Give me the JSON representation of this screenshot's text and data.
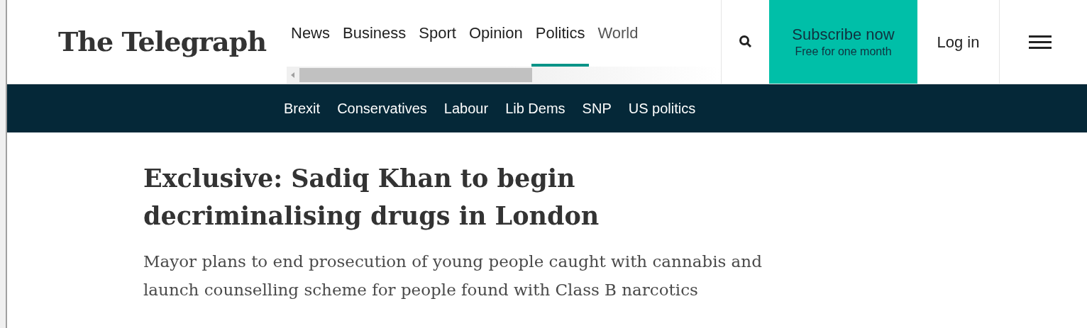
{
  "logo": "The Telegraph",
  "nav": [
    {
      "label": "News",
      "selected": false
    },
    {
      "label": "Business",
      "selected": false
    },
    {
      "label": "Sport",
      "selected": false
    },
    {
      "label": "Opinion",
      "selected": false
    },
    {
      "label": "Politics",
      "selected": true
    },
    {
      "label": "World",
      "selected": false
    }
  ],
  "subscribe": {
    "title": "Subscribe now",
    "subtitle": "Free for one month"
  },
  "login": "Log in",
  "subnav": [
    "Brexit",
    "Conservatives",
    "Labour",
    "Lib Dems",
    "SNP",
    "US politics"
  ],
  "article": {
    "headline": "Exclusive: Sadiq Khan to begin decriminalising drugs in London",
    "standfirst": "Mayor plans to end prosecution of young people caught with cannabis and launch counselling scheme for people found with Class B narcotics"
  }
}
